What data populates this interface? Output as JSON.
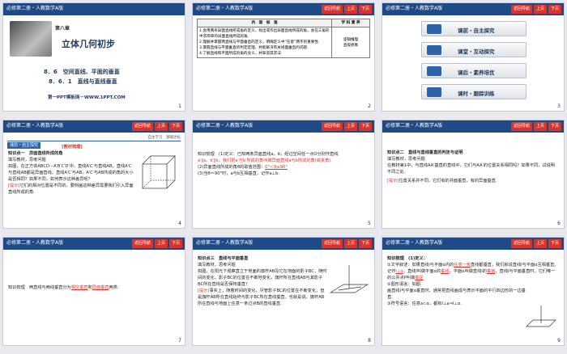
{
  "header": {
    "title": "必修第二册・人教数学A版",
    "nav_back": "返回导航",
    "nav_prev": "上页",
    "nav_next": "下页"
  },
  "slides": [
    {
      "num": "1",
      "chapter": "第八章",
      "main_title": "立体几何初步",
      "sub1": "8．6　空间直线、平面的垂直",
      "sub2": "8．6．1　直线与直线垂直",
      "footer": "第一PPT模板网－WWW.1PPT.COM"
    },
    {
      "num": "2",
      "col1": "内　容　标　准",
      "col2": "学 科 素 养",
      "rows": [
        "1.会用两条异面直线所成角的定义，找出或作出异面直线所成的角，会在三角形中求简单的异面直线所成的角.",
        "2.理解并掌握两直线与平面垂直的定义，明确定义中“任意”两字的重要性.",
        "3.掌握直线与平面垂直的判定定理，并能解决有关线面垂直的问题.",
        "4.了解直线和平面所成的角的含义，并知道其求法."
      ],
      "sk1": "逻辑推理",
      "sk2": "直观想象"
    },
    {
      "num": "3",
      "menu": [
        "课前・自主探究",
        "课堂・互动探究",
        "课后・素养培优",
        "课时・跟踪训练"
      ]
    },
    {
      "num": "4",
      "section": "课前・自主探究",
      "right_note": "自主学习　基础达标",
      "label": "[教材梳理]",
      "kp": "知识点一　异面直线所成的角",
      "req": "填写教材，思考问题",
      "q": "如图，在正方体ABCD－A′B′C′D′中，直线A′C′与直线AB，直线A′C′与直线AB都是异面直线，直线A′C′与AB，A′C′与AB所成的角的大小是否相同？如果不同，如何表示这种差异呢？",
      "tag": "[提示]",
      "ans": "它们的相对位置是不同的，要刻画这种差异需要我们引入异面直线所成的角."
    },
    {
      "num": "5",
      "text1": "知识梳理　(1)定义：已知两条异面直线a，b，经过空间任一点O分别作直线",
      "text2": "a′∥a，b′∥b，我们把a′与b′所成的角叫做异面直线a与b所成的角(或夹角).",
      "text3": "(2)异面直线所成的角θ的取值范围：",
      "range": "0°＜θ≤90°",
      "text4": "(3)当θ＝90°时，a与b互相垂直，记作a⊥b."
    },
    {
      "num": "6",
      "kp": "知识点二　直线与直线垂直的判定与证明",
      "req": "填写教材，思考问题",
      "q": "在教材第1中，与直线AA′垂直的直线中，它们与AA′的位置关系相同吗？如果不同，试说明不同之处.",
      "tag": "[提示]",
      "ans": "位置关系并不同，它们有的共面垂直，有的异面垂直."
    },
    {
      "num": "7",
      "text": "知识梳理　两直线与两线垂直分为",
      "a1": "相交垂直",
      "mid": "和",
      "a2": "异面垂直",
      "end": "两类."
    },
    {
      "num": "8",
      "kp": "知识点三　直线与平面垂直",
      "req": "填写教材，思考问题",
      "q": "如图，在阳光下观察直立于地面的旗杆AB及它在地面的影子BC，随时间的变化，影子BC的位置在不断地变化，旗杆所在直线AB与其影子BC所在直线是否保持垂直？",
      "tag": "[提示]",
      "ans": "事实上，随着时间的变化，尽管影子BC的位置在不断变化，但是旗杆AB所在直线始终与影子BC所在直线垂直，也就是说，旗杆AB所在直线与地面上任意一条过点B的直线垂直."
    },
    {
      "num": "9",
      "kp": "知识梳理　(1)定义：",
      "l1a": "①文字叙述：如果直线l与平面α内的",
      "l1b": "任意一条",
      "l1c": "直线都垂直，我们就说直线l与平面α互相垂直，记作",
      "l1d": "l⊥α",
      "l1e": "，直线l叫做平面α的",
      "l1f": "垂线",
      "l1g": "，平面α叫做直线l的",
      "l1h": "垂面",
      "l1i": "，直线l与平面垂直时，它们唯一的公共点P叫做",
      "l1j": "垂足",
      "l2": "②图形语言：如图.",
      "l3": "画直线l与平面α垂直时，通常把直线画成与表示平面的平行四边形的一边垂直.",
      "l4": "③符号语言：任意a⊂α，都有l⊥a⇒l⊥α."
    }
  ]
}
